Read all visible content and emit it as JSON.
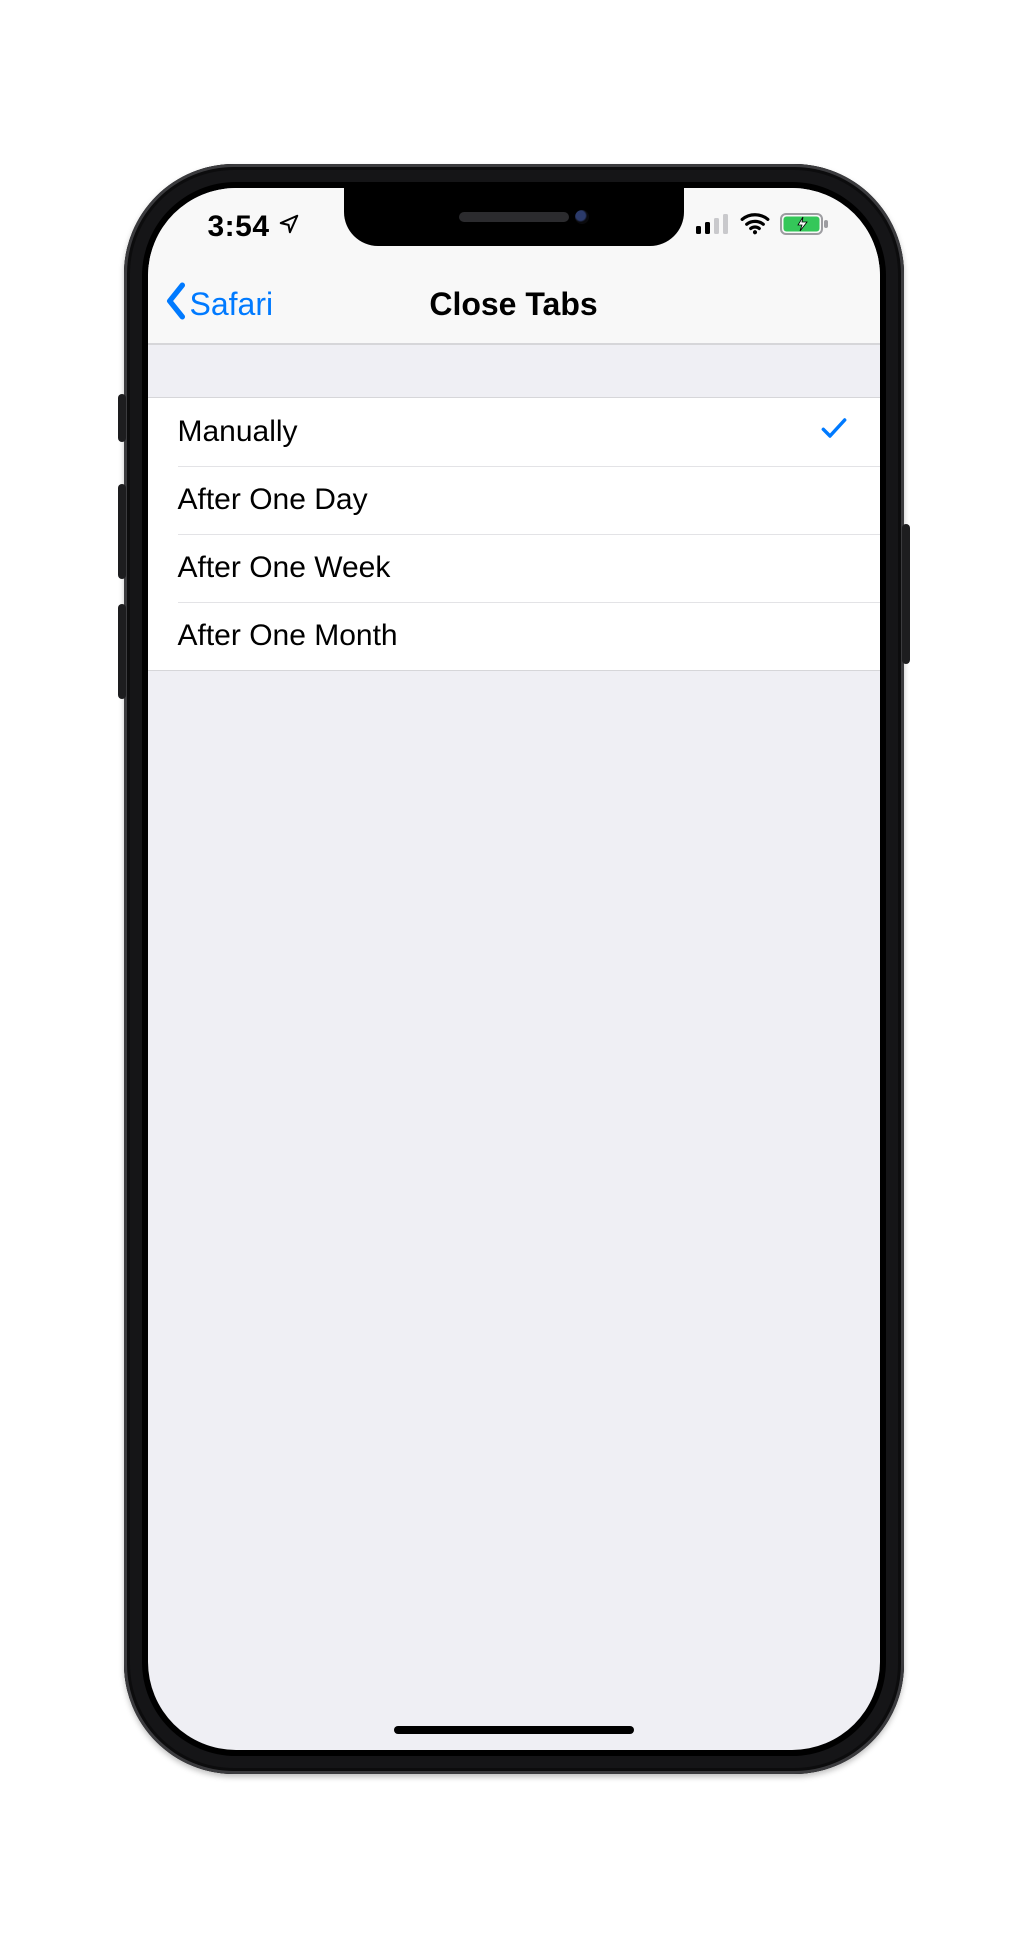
{
  "status": {
    "time": "3:54",
    "location_services": true,
    "signal_bars_active": 2,
    "signal_bars_total": 4,
    "wifi": true,
    "battery_charging": true
  },
  "nav": {
    "back_label": "Safari",
    "title": "Close Tabs"
  },
  "options": [
    {
      "label": "Manually",
      "selected": true
    },
    {
      "label": "After One Day",
      "selected": false
    },
    {
      "label": "After One Week",
      "selected": false
    },
    {
      "label": "After One Month",
      "selected": false
    }
  ],
  "colors": {
    "tint": "#007aff",
    "bg": "#efeff4",
    "row": "#ffffff",
    "hair": "#d8d8db"
  }
}
